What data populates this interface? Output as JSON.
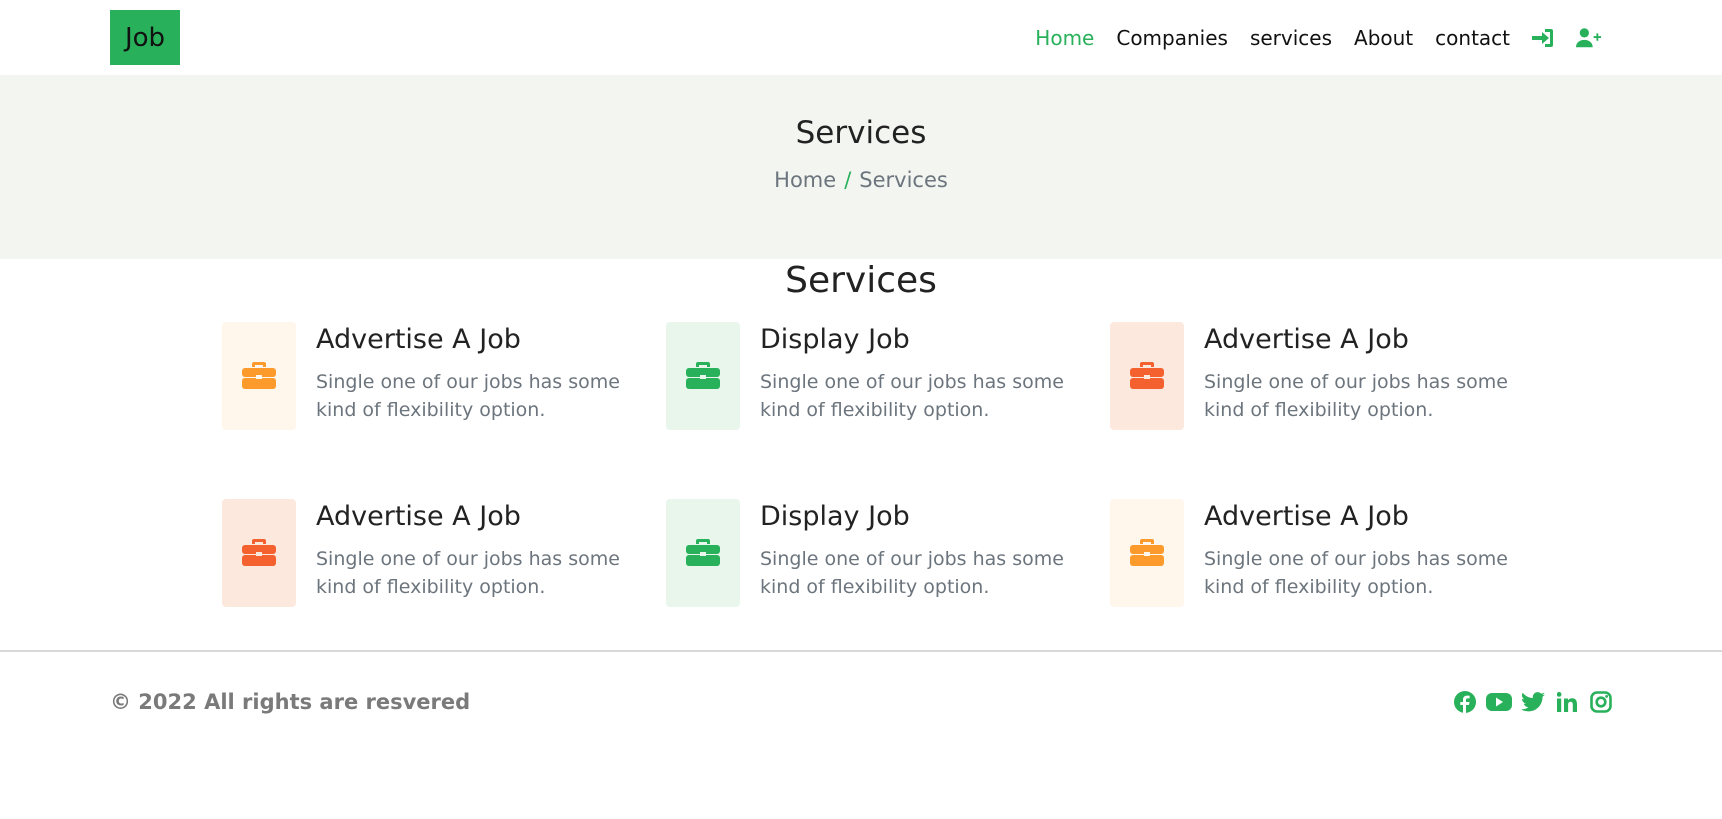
{
  "header": {
    "logo": "Job",
    "nav": [
      {
        "label": "Home",
        "active": true
      },
      {
        "label": "Companies",
        "active": false
      },
      {
        "label": "services",
        "active": false
      },
      {
        "label": "About",
        "active": false
      },
      {
        "label": "contact",
        "active": false
      }
    ],
    "icons": [
      "sign-in-icon",
      "user-plus-icon"
    ]
  },
  "banner": {
    "title": "Services",
    "breadcrumb": {
      "home": "Home",
      "separator": "/",
      "current": "Services"
    }
  },
  "section": {
    "title": "Services",
    "cards": [
      {
        "title": "Advertise A Job",
        "text": "Single one of our jobs has some kind of flexibility option.",
        "icon": "briefcase-icon",
        "color": "#fd9a2c",
        "bg": "#fff6ec"
      },
      {
        "title": "Display Job",
        "text": "Single one of our jobs has some kind of flexibility option.",
        "icon": "briefcase-icon",
        "color": "#28b15a",
        "bg": "#e8f6ec"
      },
      {
        "title": "Advertise A Job",
        "text": "Single one of our jobs has some kind of flexibility option.",
        "icon": "briefcase-icon",
        "color": "#f4602e",
        "bg": "#fde8de"
      },
      {
        "title": "Advertise A Job",
        "text": "Single one of our jobs has some kind of flexibility option.",
        "icon": "briefcase-icon",
        "color": "#f4602e",
        "bg": "#fde8de"
      },
      {
        "title": "Display Job",
        "text": "Single one of our jobs has some kind of flexibility option.",
        "icon": "briefcase-icon",
        "color": "#28b15a",
        "bg": "#e8f6ec"
      },
      {
        "title": "Advertise A Job",
        "text": "Single one of our jobs has some kind of flexibility option.",
        "icon": "briefcase-icon",
        "color": "#fd9a2c",
        "bg": "#fff6ec"
      }
    ]
  },
  "footer": {
    "copyright": "© 2022 All rights are resvered",
    "social": [
      "facebook-icon",
      "youtube-icon",
      "twitter-icon",
      "linkedin-icon",
      "instagram-icon"
    ]
  },
  "colors": {
    "accent": "#28b15a",
    "banner_bg": "#f3f5f1"
  }
}
